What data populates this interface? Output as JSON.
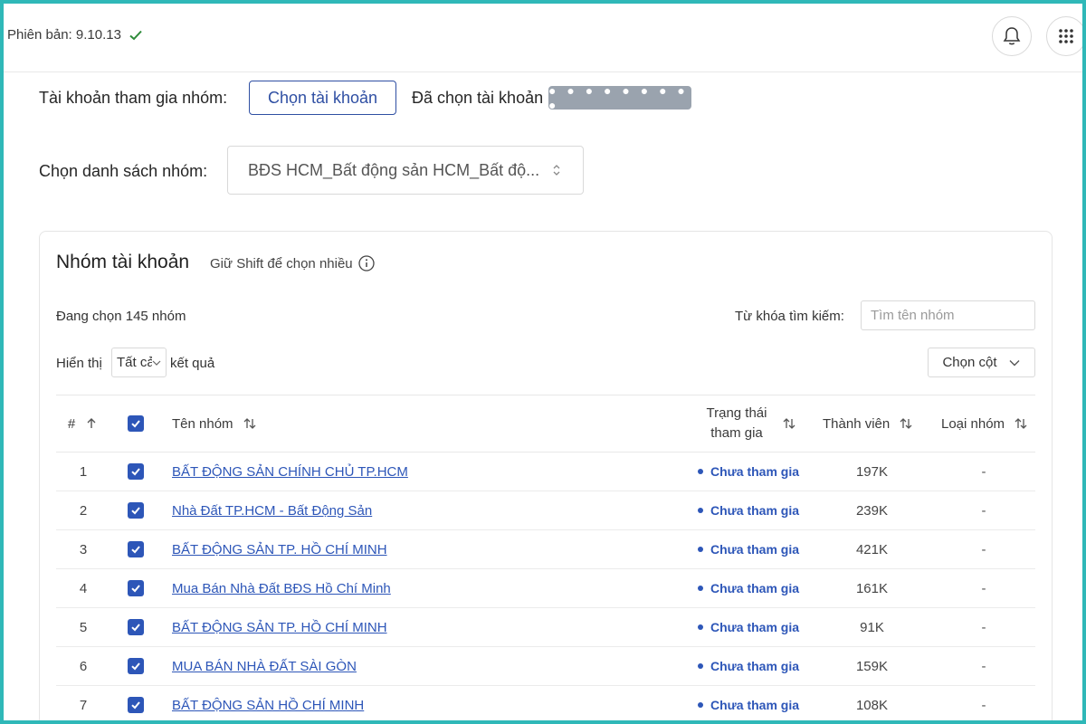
{
  "header": {
    "version": "Phiên bản: 9.10.13",
    "icons": {
      "check": "check-icon",
      "bell": "bell-icon",
      "apps": "apps-grid-icon"
    }
  },
  "account_row": {
    "label": "Tài khoản tham gia nhóm:",
    "choose_button": "Chọn tài khoản",
    "selected_label": "Đã chọn tài khoản",
    "selected_masked": "● ● ● ● ● ● ● ● ●"
  },
  "group_list_row": {
    "label": "Chọn danh sách nhóm:",
    "selected_value": "BĐS HCM_Bất động sản HCM_Bất độ..."
  },
  "card": {
    "title": "Nhóm tài khoản",
    "hint": "Giữ Shift để chọn nhiều",
    "selected_count": "Đang chọn 145 nhóm",
    "search_label": "Từ khóa tìm kiếm:",
    "search_placeholder": "Tìm tên nhóm",
    "show_label": "Hiển thị",
    "show_value": "Tất cả",
    "results_label": "kết quả",
    "columns_button": "Chọn cột"
  },
  "table": {
    "headers": {
      "num": "#",
      "name": "Tên nhóm",
      "status_line1": "Trạng thái",
      "status_line2": "tham gia",
      "members": "Thành viên",
      "type": "Loại nhóm"
    },
    "rows": [
      {
        "num": "1",
        "name": "BẤT ĐỘNG SẢN CHÍNH CHỦ TP.HCM",
        "status": "Chưa tham gia",
        "members": "197K",
        "type": "-"
      },
      {
        "num": "2",
        "name": "Nhà Đất TP.HCM - Bất Động Sản",
        "status": "Chưa tham gia",
        "members": "239K",
        "type": "-"
      },
      {
        "num": "3",
        "name": "BẤT ĐỘNG SẢN TP. HỒ CHÍ MINH",
        "status": "Chưa tham gia",
        "members": "421K",
        "type": "-"
      },
      {
        "num": "4",
        "name": "Mua Bán Nhà Đất BĐS Hồ Chí Minh",
        "status": "Chưa tham gia",
        "members": "161K",
        "type": "-"
      },
      {
        "num": "5",
        "name": "BẤT ĐỘNG SẢN TP. HỒ CHÍ MINH",
        "status": "Chưa tham gia",
        "members": "91K",
        "type": "-"
      },
      {
        "num": "6",
        "name": "MUA BÁN NHÀ ĐẤT SÀI GÒN",
        "status": "Chưa tham gia",
        "members": "159K",
        "type": "-"
      },
      {
        "num": "7",
        "name": "BẤT ĐỘNG SẢN HỒ CHÍ MINH",
        "status": "Chưa tham gia",
        "members": "108K",
        "type": "-"
      }
    ]
  },
  "colors": {
    "accent": "#2d56b8",
    "frame": "#2fb8b8",
    "mask": "#9aa3ae"
  }
}
